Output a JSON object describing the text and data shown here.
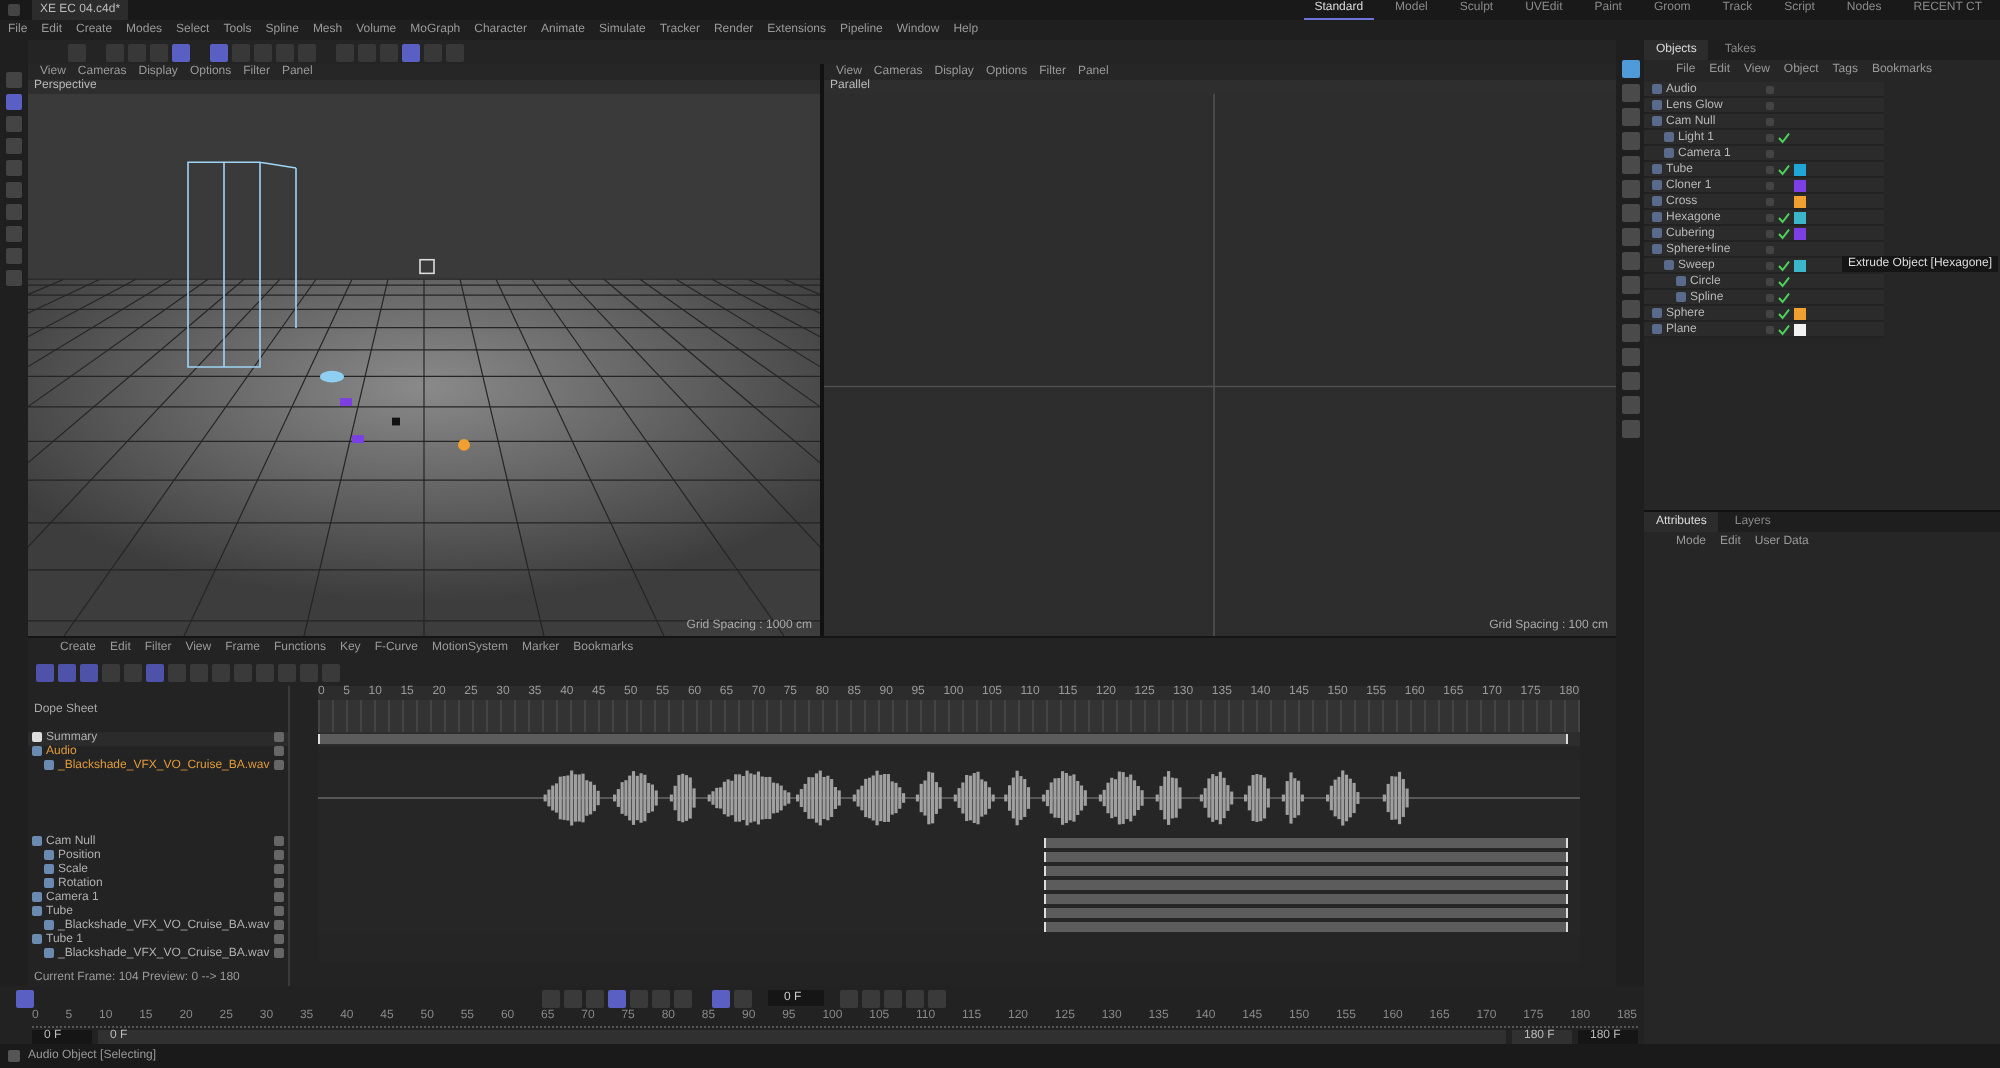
{
  "title_bar": {
    "document_tab": "XE EC 04.c4d*",
    "layouts": [
      {
        "label": "Standard",
        "selected": true
      },
      {
        "label": "Model",
        "selected": false
      },
      {
        "label": "Sculpt",
        "selected": false
      },
      {
        "label": "UVEdit",
        "selected": false
      },
      {
        "label": "Paint",
        "selected": false
      },
      {
        "label": "Groom",
        "selected": false
      },
      {
        "label": "Track",
        "selected": false
      },
      {
        "label": "Script",
        "selected": false
      },
      {
        "label": "Nodes",
        "selected": false
      },
      {
        "label": "RECENT CT",
        "selected": false
      }
    ]
  },
  "menu_bar": [
    "File",
    "Edit",
    "Create",
    "Modes",
    "Select",
    "Tools",
    "Spline",
    "Mesh",
    "Volume",
    "MoGraph",
    "Character",
    "Animate",
    "Simulate",
    "Tracker",
    "Render",
    "Extensions",
    "Pipeline",
    "Window",
    "Help"
  ],
  "toolbar": [
    {
      "active": false
    },
    {
      "active": false
    },
    {
      "active": false
    },
    {
      "active": false
    },
    {
      "active": true
    },
    {
      "active": true
    },
    {
      "active": false
    },
    {
      "active": false
    },
    {
      "active": false
    },
    {
      "active": false
    },
    {
      "active": false
    },
    {
      "active": false
    },
    {
      "active": false
    },
    {
      "active": true
    },
    {
      "active": false
    },
    {
      "active": false
    }
  ],
  "viewports": [
    {
      "kind": "perspective",
      "name": "Perspective",
      "menu": [
        "View",
        "Cameras",
        "Display",
        "Options",
        "Filter",
        "Panel"
      ],
      "grid_spacing": "Grid Spacing : 1000 cm"
    },
    {
      "kind": "parallel",
      "name": "Parallel",
      "menu": [
        "View",
        "Cameras",
        "Display",
        "Options",
        "Filter",
        "Panel"
      ],
      "grid_spacing": "Grid Spacing : 100 cm"
    }
  ],
  "object_manager": {
    "tabs": [
      {
        "label": "Objects",
        "selected": true
      },
      {
        "label": "Takes",
        "selected": false
      }
    ],
    "menu": [
      "File",
      "Edit",
      "View",
      "Object",
      "Tags",
      "Bookmarks"
    ],
    "objects": [
      {
        "name": "Audio",
        "checked": false
      },
      {
        "name": "Lens Glow",
        "checked": false
      },
      {
        "name": "Cam Null",
        "checked": false,
        "children": [
          {
            "name": "Light 1",
            "checked": true
          },
          {
            "name": "Camera 1",
            "checked": false
          }
        ]
      },
      {
        "name": "Tube",
        "checked": true,
        "color": "#1fa6d6"
      },
      {
        "name": "Cloner 1",
        "checked": false,
        "color": "#7b3fe4"
      },
      {
        "name": "Cross",
        "checked": false,
        "color": "#f0a030"
      },
      {
        "name": "Hexagone",
        "checked": true,
        "color": "#3bb7c9"
      },
      {
        "name": "Cubering",
        "checked": true,
        "color": "#7b3fe4"
      },
      {
        "name": "Sphere+line",
        "checked": false,
        "children": [
          {
            "name": "Sweep",
            "checked": true,
            "color": "#3bb7c9",
            "children": [
              {
                "name": "Circle",
                "checked": true
              },
              {
                "name": "Spline",
                "checked": true
              }
            ]
          }
        ]
      },
      {
        "name": "Sphere",
        "checked": true,
        "color": "#f0a030"
      },
      {
        "name": "Plane",
        "checked": true,
        "color": "#f2f2f2"
      }
    ],
    "tooltip": "Extrude Object [Hexagone]"
  },
  "attributes": {
    "tabs": [
      {
        "label": "Attributes",
        "selected": true
      },
      {
        "label": "Layers",
        "selected": false
      }
    ],
    "menu": [
      "Mode",
      "Edit",
      "User Data"
    ]
  },
  "timeline": {
    "menu": [
      "Create",
      "Edit",
      "Filter",
      "View",
      "Frame",
      "Functions",
      "Key",
      "F-Curve",
      "MotionSystem",
      "Marker",
      "Bookmarks"
    ],
    "title": "Dope Sheet",
    "ruler": [
      "0",
      "5",
      "10",
      "15",
      "20",
      "25",
      "30",
      "35",
      "40",
      "45",
      "50",
      "55",
      "60",
      "65",
      "70",
      "75",
      "80",
      "85",
      "90",
      "95",
      "100",
      "105",
      "110",
      "115",
      "120",
      "125",
      "130",
      "135",
      "140",
      "145",
      "150",
      "155",
      "160",
      "165",
      "170",
      "175",
      "180"
    ],
    "tracks": [
      {
        "kind": "summary",
        "name": "Summary"
      },
      {
        "kind": "object",
        "name": "Audio",
        "highlight": true,
        "children": [
          {
            "kind": "sound",
            "name": "_Blackshade_VFX_VO_Cruise_BA.wav",
            "highlight": true
          }
        ]
      },
      {
        "kind": "keys",
        "name": "Cam Null",
        "highlight": false,
        "children": [
          {
            "kind": "keys",
            "name": "Position"
          },
          {
            "kind": "keys",
            "name": "Scale"
          },
          {
            "kind": "keys",
            "name": "Rotation"
          }
        ]
      },
      {
        "kind": "keys",
        "name": "Camera 1",
        "highlight": false
      },
      {
        "kind": "keys",
        "name": "Tube",
        "highlight": false,
        "children": [
          {
            "kind": "keys",
            "name": "_Blackshade_VFX_VO_Cruise_BA.wav"
          }
        ]
      },
      {
        "kind": "object",
        "name": "Tube 1",
        "highlight": false,
        "children": [
          {
            "kind": "object",
            "name": "_Blackshade_VFX_VO_Cruise_BA.wav"
          }
        ]
      }
    ],
    "status": "Current Frame: 104  Preview: 0 --> 180"
  },
  "transport": {
    "frame_field": "0 F",
    "ruler": [
      "0",
      "5",
      "10",
      "15",
      "20",
      "25",
      "30",
      "35",
      "40",
      "45",
      "50",
      "55",
      "60",
      "65",
      "70",
      "75",
      "80",
      "85",
      "90",
      "95",
      "100",
      "105",
      "110",
      "115",
      "120",
      "125",
      "130",
      "135",
      "140",
      "145",
      "150",
      "155",
      "160",
      "165",
      "170",
      "175",
      "180",
      "185"
    ],
    "start": "0 F",
    "preview_start": "0 F",
    "preview_range": {
      "level": 1
    },
    "preview_end": "180 F",
    "end": "180 F"
  },
  "status_bar": "Audio Object [Selecting]"
}
